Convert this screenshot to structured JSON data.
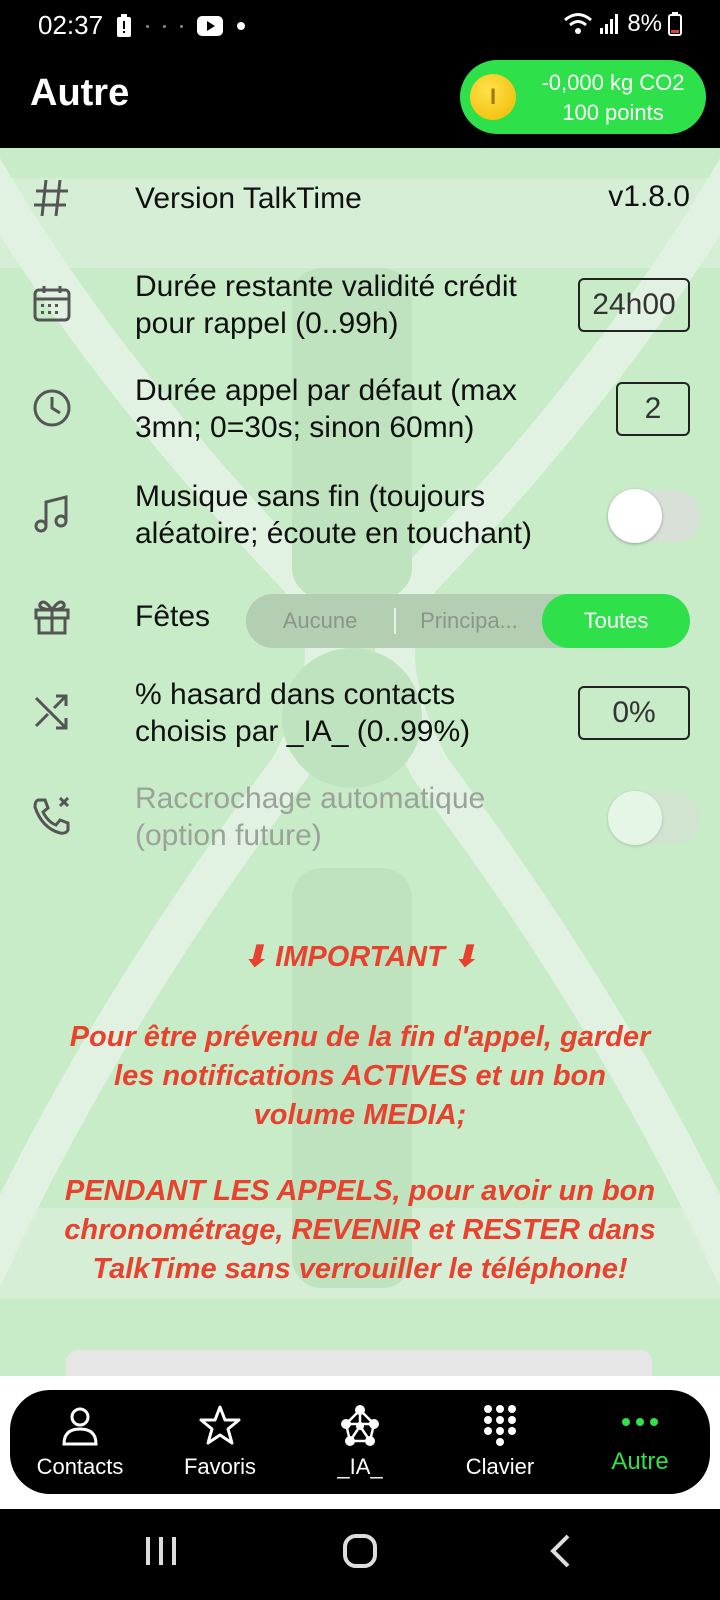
{
  "status_bar": {
    "time": "02:37",
    "battery": "8%"
  },
  "header": {
    "title": "Autre",
    "eco": {
      "co2": "-0,000 kg CO2",
      "points": "100 points",
      "coin_glyph": "I"
    }
  },
  "settings": {
    "version": {
      "label": "Version TalkTime",
      "value": "v1.8.0",
      "icon": "hash-icon"
    },
    "credit": {
      "label_line1": "Durée restante validité crédit",
      "label_line2": "pour rappel (0..99h)",
      "value": "24h00",
      "icon": "calendar-icon"
    },
    "call_duration": {
      "label_line1": "Durée appel par défaut (max",
      "label_line2": "3mn; 0=30s; sinon 60mn)",
      "value": "2",
      "icon": "clock-icon"
    },
    "music": {
      "label_line1": "Musique sans fin (toujours",
      "label_line2": "aléatoire; écoute en touchant)",
      "enabled": false,
      "icon": "music-note-icon"
    },
    "holidays": {
      "label": "Fêtes",
      "options": [
        "Aucune",
        "Principa...",
        "Toutes"
      ],
      "selected": "Toutes",
      "icon": "gift-icon"
    },
    "random": {
      "label_line1": "% hasard dans contacts",
      "label_line2": "choisis par _IA_ (0..99%)",
      "value": "0%",
      "icon": "shuffle-icon"
    },
    "auto_hangup": {
      "label_line1": "Raccrochage automatique",
      "label_line2": "(option future)",
      "enabled": false,
      "disabled": true,
      "icon": "phone-x-icon"
    }
  },
  "important": {
    "title": "⬇ IMPORTANT ⬇",
    "p1_line1": "Pour être prévenu de la fin d'appel, garder",
    "p1_line2": "les notifications ACTIVES et un bon",
    "p1_line3": "volume MEDIA;",
    "p2_line1": "PENDANT LES APPELS, pour avoir un bon",
    "p2_line2": "chronométrage, REVENIR et RESTER dans",
    "p2_line3": "TalkTime sans verrouiller le téléphone!"
  },
  "nav": {
    "items": [
      {
        "label": "Contacts",
        "icon": "person-icon"
      },
      {
        "label": "Favoris",
        "icon": "star-icon"
      },
      {
        "label": "_IA_",
        "icon": "ai-network-icon"
      },
      {
        "label": "Clavier",
        "icon": "dialpad-icon"
      },
      {
        "label": "Autre",
        "icon": "more-dots-icon"
      }
    ],
    "active": "Autre"
  },
  "colors": {
    "accent": "#2ee04a",
    "warning": "#e8412d",
    "content_bg": "#c8ebc8"
  }
}
